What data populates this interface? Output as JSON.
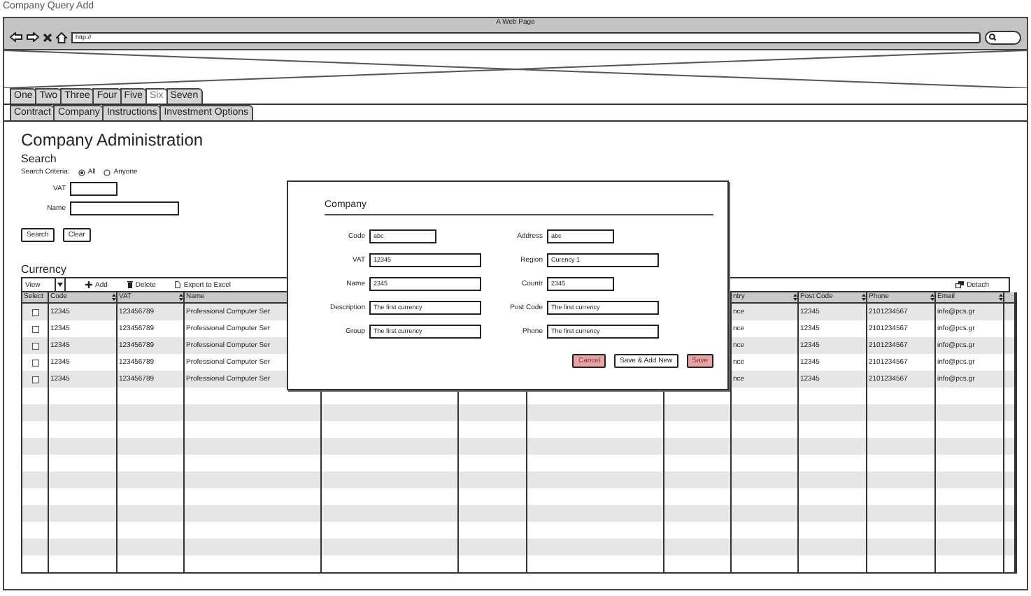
{
  "page_title": "Company Query Add",
  "browser": {
    "title": "A Web Page",
    "url": "http://"
  },
  "tabs": [
    {
      "label": "One",
      "selected": false
    },
    {
      "label": "Two",
      "selected": false
    },
    {
      "label": "Three",
      "selected": false
    },
    {
      "label": "Four",
      "selected": false
    },
    {
      "label": "Five",
      "selected": false
    },
    {
      "label": "Six",
      "selected": true
    },
    {
      "label": "Seven",
      "selected": false
    }
  ],
  "subtabs": [
    {
      "label": "Contract",
      "selected": false
    },
    {
      "label": "Company",
      "selected": false
    },
    {
      "label": "Instructions",
      "selected": false
    },
    {
      "label": "Investment Options",
      "selected": false
    }
  ],
  "heading": "Company Administration",
  "search": {
    "title": "Search",
    "criteria_label": "Search Criteria:",
    "options": [
      {
        "label": "All",
        "selected": true
      },
      {
        "label": "Anyone",
        "selected": false
      }
    ],
    "fields": [
      {
        "label": "VAT"
      },
      {
        "label": "Name"
      }
    ],
    "buttons": [
      "Search",
      "Clear"
    ]
  },
  "currency": {
    "title": "Currency",
    "toolbar": {
      "view": "View",
      "actions": [
        "Add",
        "Delete",
        "Export to Excel"
      ],
      "detach": "Detach"
    },
    "columns": [
      {
        "label": "Select",
        "sortable": false
      },
      {
        "label": "Code",
        "sortable": true
      },
      {
        "label": "VAT",
        "sortable": true
      },
      {
        "label": "Name"
      },
      {
        "label": "ntry",
        "sortable": true
      },
      {
        "label": "Post Code",
        "sortable": true
      },
      {
        "label": "Phone",
        "sortable": true
      },
      {
        "label": "Email",
        "sortable": true
      }
    ],
    "rows": [
      {
        "checked": false,
        "cells": [
          "",
          "12345",
          "123456789",
          "Professional Computer Ser",
          "nce",
          "12345",
          "2101234567",
          "info@pcs.gr"
        ]
      },
      {
        "checked": false,
        "cells": [
          "",
          "12345",
          "123456789",
          "Professional Computer Ser",
          "nce",
          "12345",
          "2101234567",
          "info@pcs.gr"
        ]
      },
      {
        "checked": false,
        "cells": [
          "",
          "12345",
          "123456789",
          "Professional Computer Ser",
          "nce",
          "12345",
          "2101234567",
          "info@pcs.gr"
        ]
      },
      {
        "checked": false,
        "cells": [
          "",
          "12345",
          "123456789",
          "Professional Computer Ser",
          "nce",
          "12345",
          "2101234567",
          "info@pcs.gr"
        ]
      },
      {
        "checked": false,
        "cells": [
          "",
          "12345",
          "123456789",
          "Professional Computer Ser",
          "nce",
          "12345",
          "2101234567",
          "info@pcs.gr"
        ]
      }
    ]
  },
  "dialog": {
    "title": "Company",
    "left_fields": [
      {
        "label": "Code",
        "value": "abc"
      },
      {
        "label": "VAT",
        "value": "12345"
      },
      {
        "label": "Name",
        "value": "2345"
      },
      {
        "label": "Description",
        "value": "The first currency"
      },
      {
        "label": "Group",
        "value": "The first currency"
      }
    ],
    "right_fields": [
      {
        "label": "Address",
        "value": "abc"
      },
      {
        "label": "Region",
        "value": "Curency 1"
      },
      {
        "label": "Countr",
        "value": "2345"
      },
      {
        "label": "Post Code",
        "value": "The first currency"
      },
      {
        "label": "Phone",
        "value": "The first currency"
      }
    ],
    "buttons": [
      {
        "label": "Cancel",
        "kind": "accent"
      },
      {
        "label": "Save & Add New",
        "kind": "plain"
      },
      {
        "label": "Save",
        "kind": "accent"
      }
    ]
  }
}
